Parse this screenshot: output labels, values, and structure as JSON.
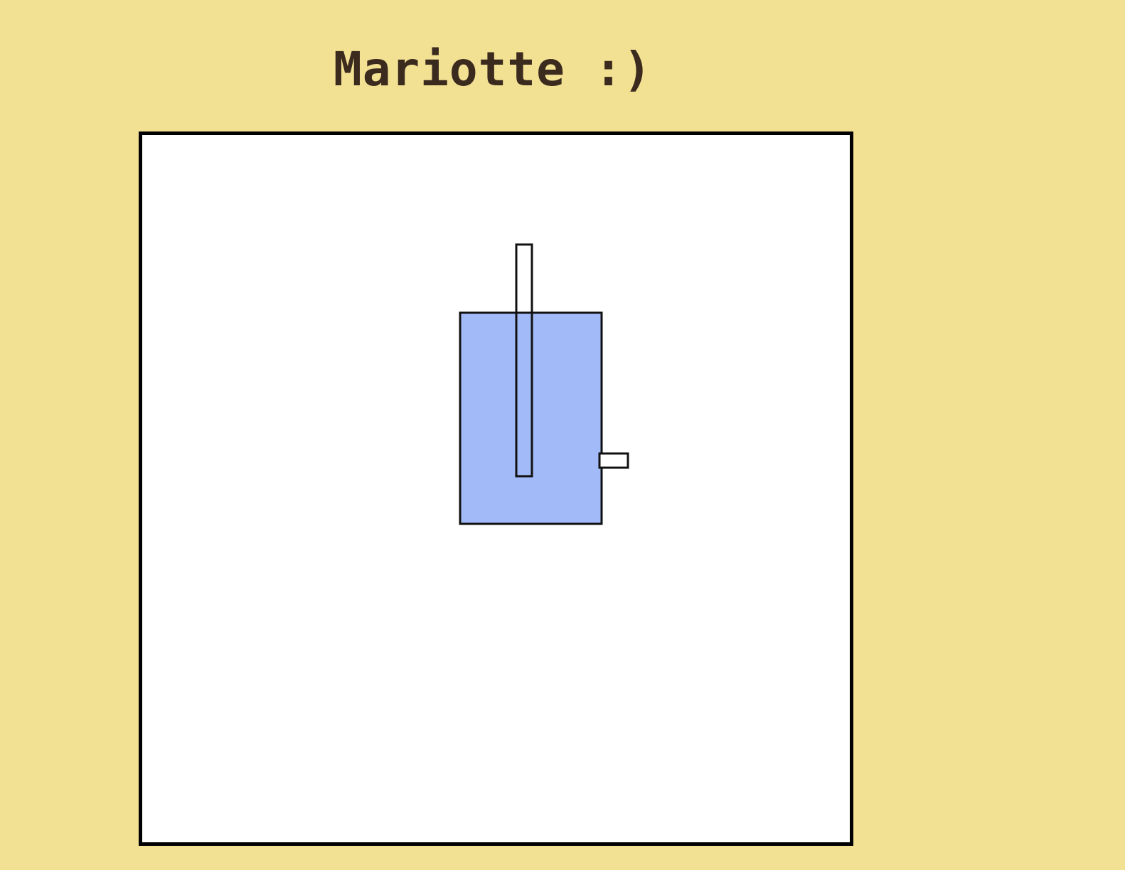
{
  "title": "Mariotte :)",
  "colors": {
    "page_background": "#F2E093",
    "title_text": "#3B2A1E",
    "canvas_background": "#FFFFFF",
    "canvas_border": "#000000",
    "water": "#A2BAF8",
    "tube_fill": "#FFFFFF",
    "outline": "#111111"
  },
  "scene": {
    "objects": [
      {
        "name": "mariotte-bottle-water",
        "fill": "water"
      },
      {
        "name": "air-inlet-tube-above-water",
        "fill": "tube_fill"
      },
      {
        "name": "air-inlet-tube-submerged",
        "fill": "water"
      },
      {
        "name": "outlet-spout",
        "fill": "tube_fill"
      }
    ]
  }
}
